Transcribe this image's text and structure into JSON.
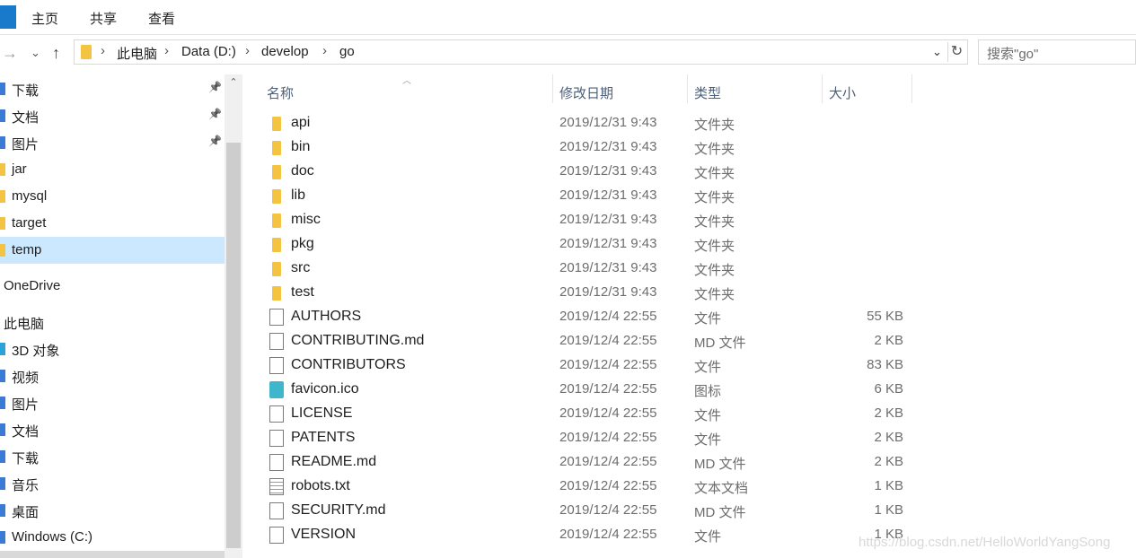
{
  "ribbon": {
    "tabs": [
      "主页",
      "共享",
      "查看"
    ]
  },
  "nav": {
    "path": [
      "此电脑",
      "Data (D:)",
      "develop",
      "go"
    ],
    "search_placeholder": "搜索\"go\""
  },
  "sidebar": {
    "items": [
      {
        "label": "下载",
        "pinned": true,
        "icon": "download-icon"
      },
      {
        "label": "文档",
        "pinned": true,
        "icon": "document-icon"
      },
      {
        "label": "图片",
        "pinned": true,
        "icon": "pictures-icon"
      },
      {
        "label": "jar",
        "pinned": false,
        "icon": "folder-icon"
      },
      {
        "label": "mysql",
        "pinned": false,
        "icon": "folder-icon"
      },
      {
        "label": "target",
        "pinned": false,
        "icon": "folder-icon"
      },
      {
        "label": "temp",
        "pinned": false,
        "icon": "folder-icon",
        "selected": true
      },
      {
        "label": "OneDrive",
        "root": true,
        "icon": "cloud-icon"
      },
      {
        "label": "此电脑",
        "root": true,
        "icon": "computer-icon"
      },
      {
        "label": "3D 对象",
        "icon": "cube-icon"
      },
      {
        "label": "视频",
        "icon": "video-icon"
      },
      {
        "label": "图片",
        "icon": "pictures-icon"
      },
      {
        "label": "文档",
        "icon": "document-icon"
      },
      {
        "label": "下载",
        "icon": "download-icon"
      },
      {
        "label": "音乐",
        "icon": "music-icon"
      },
      {
        "label": "桌面",
        "icon": "desktop-icon"
      },
      {
        "label": "Windows (C:)",
        "icon": "drive-icon"
      }
    ]
  },
  "list": {
    "headers": {
      "name": "名称",
      "date": "修改日期",
      "type": "类型",
      "size": "大小"
    },
    "files": [
      {
        "name": "api",
        "date": "2019/12/31 9:43",
        "type": "文件夹",
        "size": "",
        "kind": "folder"
      },
      {
        "name": "bin",
        "date": "2019/12/31 9:43",
        "type": "文件夹",
        "size": "",
        "kind": "folder"
      },
      {
        "name": "doc",
        "date": "2019/12/31 9:43",
        "type": "文件夹",
        "size": "",
        "kind": "folder"
      },
      {
        "name": "lib",
        "date": "2019/12/31 9:43",
        "type": "文件夹",
        "size": "",
        "kind": "folder"
      },
      {
        "name": "misc",
        "date": "2019/12/31 9:43",
        "type": "文件夹",
        "size": "",
        "kind": "folder"
      },
      {
        "name": "pkg",
        "date": "2019/12/31 9:43",
        "type": "文件夹",
        "size": "",
        "kind": "folder"
      },
      {
        "name": "src",
        "date": "2019/12/31 9:43",
        "type": "文件夹",
        "size": "",
        "kind": "folder"
      },
      {
        "name": "test",
        "date": "2019/12/31 9:43",
        "type": "文件夹",
        "size": "",
        "kind": "folder"
      },
      {
        "name": "AUTHORS",
        "date": "2019/12/4 22:55",
        "type": "文件",
        "size": "55 KB",
        "kind": "file"
      },
      {
        "name": "CONTRIBUTING.md",
        "date": "2019/12/4 22:55",
        "type": "MD 文件",
        "size": "2 KB",
        "kind": "file"
      },
      {
        "name": "CONTRIBUTORS",
        "date": "2019/12/4 22:55",
        "type": "文件",
        "size": "83 KB",
        "kind": "file"
      },
      {
        "name": "favicon.ico",
        "date": "2019/12/4 22:55",
        "type": "图标",
        "size": "6 KB",
        "kind": "ico"
      },
      {
        "name": "LICENSE",
        "date": "2019/12/4 22:55",
        "type": "文件",
        "size": "2 KB",
        "kind": "file"
      },
      {
        "name": "PATENTS",
        "date": "2019/12/4 22:55",
        "type": "文件",
        "size": "2 KB",
        "kind": "file"
      },
      {
        "name": "README.md",
        "date": "2019/12/4 22:55",
        "type": "MD 文件",
        "size": "2 KB",
        "kind": "file"
      },
      {
        "name": "robots.txt",
        "date": "2019/12/4 22:55",
        "type": "文本文档",
        "size": "1 KB",
        "kind": "txt"
      },
      {
        "name": "SECURITY.md",
        "date": "2019/12/4 22:55",
        "type": "MD 文件",
        "size": "1 KB",
        "kind": "file"
      },
      {
        "name": "VERSION",
        "date": "2019/12/4 22:55",
        "type": "文件",
        "size": "1 KB",
        "kind": "file"
      }
    ]
  },
  "watermark": "https://blog.csdn.net/HelloWorldYangSong"
}
